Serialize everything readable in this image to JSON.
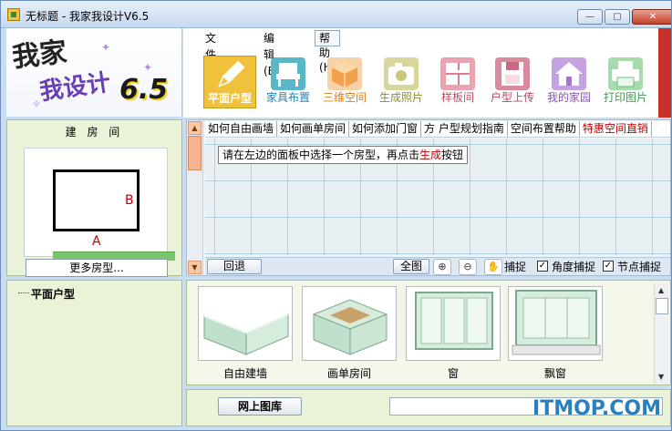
{
  "window": {
    "title": "无标题 - 我家我设计V6.5",
    "minimize": "—",
    "restore": "▢",
    "close": "✕"
  },
  "logo": {
    "line1": "我家",
    "line2": "我设计",
    "version": "6.5"
  },
  "menu": [
    {
      "label": "文件(F)"
    },
    {
      "label": "编辑(E)"
    },
    {
      "label": "帮助(H)"
    }
  ],
  "toolbar": [
    {
      "label": "平面户型",
      "icon": "pencil-icon",
      "color": "#f0c23c",
      "selected": true
    },
    {
      "label": "家具布置",
      "icon": "chair-icon",
      "color": "#5ab7c7"
    },
    {
      "label": "三维空间",
      "icon": "cube-icon",
      "color": "#f3a24b"
    },
    {
      "label": "生成照片",
      "icon": "camera-icon",
      "color": "#c8c87a"
    },
    {
      "label": "样板间",
      "icon": "floorplan-icon",
      "color": "#e07a8e"
    },
    {
      "label": "户型上传",
      "icon": "floppy-icon",
      "color": "#c56a80"
    },
    {
      "label": "我的家园",
      "icon": "house-icon",
      "color": "#a577c9"
    },
    {
      "label": "打印图片",
      "icon": "printer-icon",
      "color": "#6dbf78"
    }
  ],
  "left_panel": {
    "header": "建 房 间",
    "label_a": "A",
    "label_b": "B",
    "more_button": "更多房型..."
  },
  "tree": {
    "root": "平面户型"
  },
  "canvas": {
    "tabs": [
      {
        "label": "如何自由画墙"
      },
      {
        "label": "如何画单房间"
      },
      {
        "label": "如何添加门窗"
      },
      {
        "label": "方 户型规划指南"
      },
      {
        "label": "空间布置帮助"
      },
      {
        "label": "特惠空间直销",
        "hot": true
      }
    ],
    "hint_prefix": "请在左边的面板中选择一个房型，再点击",
    "hint_red": "生成",
    "hint_suffix": "按钮",
    "back_button": "回退",
    "fit_button": "全图",
    "capture_label": "捕捉",
    "angle_capture_label": "角度捕捉",
    "node_capture_label": "节点捕捉",
    "angle_capture_checked": true,
    "node_capture_checked": true
  },
  "gallery": {
    "items": [
      {
        "label": "自由建墙"
      },
      {
        "label": "画单房间"
      },
      {
        "label": "窗"
      },
      {
        "label": "飘窗"
      }
    ]
  },
  "footer": {
    "online_gallery_button": "网上图库",
    "watermark": "ITMOP.COM"
  }
}
